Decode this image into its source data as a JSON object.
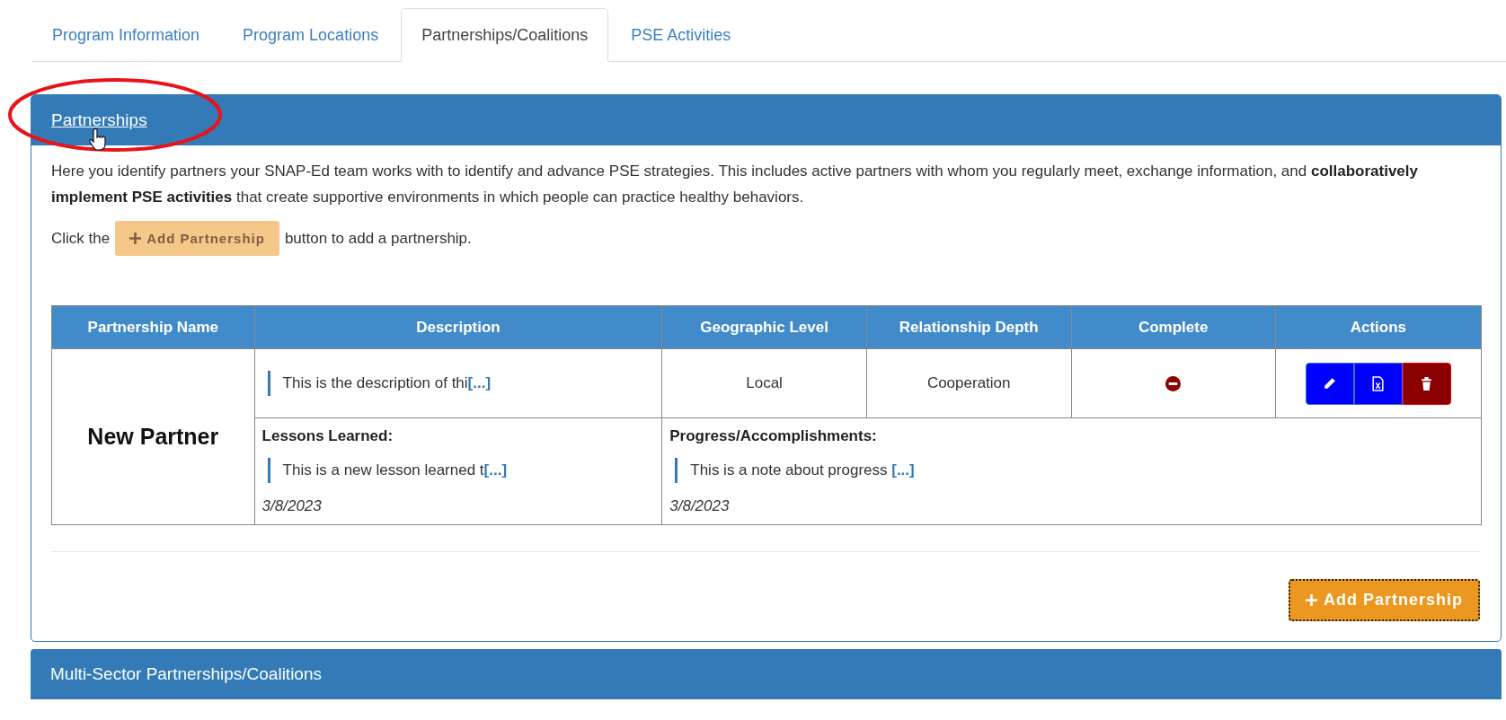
{
  "tabs": [
    {
      "label": "Program Information",
      "selected": false
    },
    {
      "label": "Program Locations",
      "selected": false
    },
    {
      "label": "Partnerships/Coalitions",
      "selected": true
    },
    {
      "label": "PSE Activities",
      "selected": false
    }
  ],
  "panel": {
    "title": "Partnerships",
    "intro": "Here you identify partners your SNAP-Ed team works with to identify and advance PSE strategies. This includes active partners with whom you regularly meet, exchange information, and **collaboratively implement PSE activities** that create supportive environments in which people can practice healthy behaviors.",
    "instruction_before": "Click the",
    "instruction_button": "Add Partnership",
    "instruction_after": "button to add a partnership.",
    "table": {
      "columns": [
        "Partnership Name",
        "Description",
        "Geographic Level",
        "Relationship Depth",
        "Complete",
        "Actions"
      ],
      "rows": [
        {
          "name": "New Partner",
          "description": "This is the description of thi",
          "description_more": "[...]",
          "geographic_level": "Local",
          "relationship_depth": "Cooperation",
          "complete": false,
          "actions": [
            {
              "kind": "edit"
            },
            {
              "kind": "export"
            },
            {
              "kind": "delete"
            }
          ],
          "lessons": {
            "label": "Lessons Learned:",
            "text": "This is a new lesson learned t",
            "more": "[...]",
            "date": "3/8/2023"
          },
          "progress": {
            "label": "Progress/Accomplishments:",
            "text": "This is a note about progress ",
            "more": "[...]",
            "date": "3/8/2023"
          }
        }
      ]
    },
    "add_button": "Add Partnership"
  },
  "next_panel": {
    "title": "Multi-Sector Partnerships/Coalitions"
  }
}
